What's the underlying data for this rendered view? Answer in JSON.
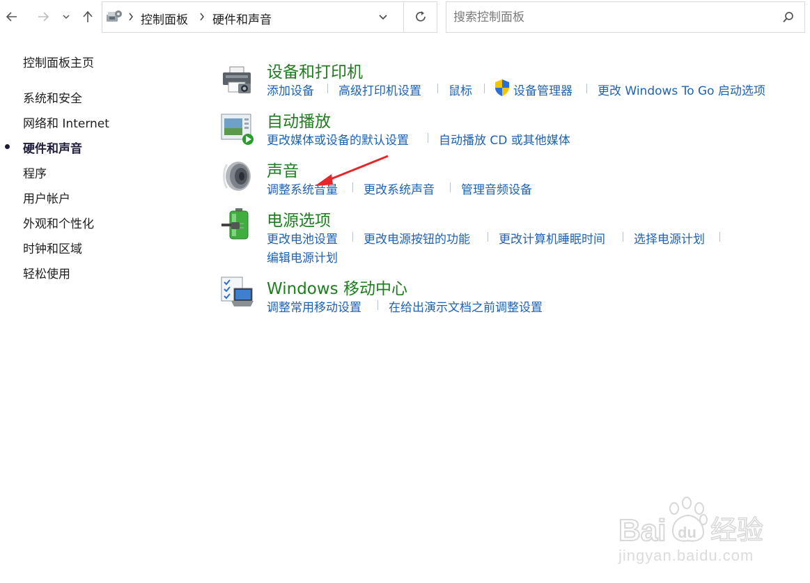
{
  "address_bar": {
    "breadcrumbs": [
      "控制面板",
      "硬件和声音"
    ]
  },
  "search": {
    "placeholder": "搜索控制面板"
  },
  "sidebar": {
    "home": "控制面板主页",
    "items": [
      {
        "label": "系统和安全",
        "selected": false
      },
      {
        "label": "网络和 Internet",
        "selected": false
      },
      {
        "label": "硬件和声音",
        "selected": true
      },
      {
        "label": "程序",
        "selected": false
      },
      {
        "label": "用户帐户",
        "selected": false
      },
      {
        "label": "外观和个性化",
        "selected": false
      },
      {
        "label": "时钟和区域",
        "selected": false
      },
      {
        "label": "轻松使用",
        "selected": false
      }
    ]
  },
  "categories": [
    {
      "title": "设备和打印机",
      "icon": "printer-icon",
      "links": [
        "添加设备",
        "高级打印机设置",
        "鼠标",
        "设备管理器",
        "更改 Windows To Go 启动选项"
      ]
    },
    {
      "title": "自动播放",
      "icon": "autoplay-icon",
      "links": [
        "更改媒体或设备的默认设置",
        "自动播放 CD 或其他媒体"
      ]
    },
    {
      "title": "声音",
      "icon": "speaker-icon",
      "links": [
        "调整系统音量",
        "更改系统声音",
        "管理音频设备"
      ]
    },
    {
      "title": "电源选项",
      "icon": "power-battery-icon",
      "links": [
        "更改电池设置",
        "更改电源按钮的功能",
        "更改计算机睡眠时间",
        "选择电源计划",
        "编辑电源计划"
      ]
    },
    {
      "title": "Windows 移动中心",
      "icon": "mobility-center-icon",
      "links": [
        "调整常用移动设置",
        "在给出演示文档之前调整设置"
      ]
    }
  ],
  "watermark": {
    "brand": "Bai du 经验",
    "url": "jingyan.baidu.com"
  },
  "colors": {
    "category_title": "#1e7d1e",
    "link": "#1e62b4",
    "annotation_arrow": "#e8262a"
  }
}
